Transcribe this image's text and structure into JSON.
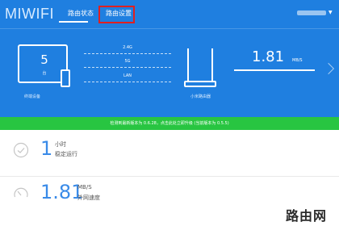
{
  "app": {
    "logo_text": "MIWIFI"
  },
  "nav": {
    "tabs": [
      {
        "label": "路由状态",
        "active": true
      },
      {
        "label": "路由设置",
        "active": false
      }
    ]
  },
  "dashboard": {
    "devices": {
      "count": "5",
      "count_caption": "台",
      "caption": "终端设备"
    },
    "connections": [
      "2.4G",
      "5G",
      "LAN"
    ],
    "router_caption": "小米路由器",
    "speed": {
      "value": "1.81",
      "unit": "MB/S"
    }
  },
  "notice": {
    "text": "检测到最新版本为 0.6.28，点击此处立即升级 (当前版本为 0.5.5)"
  },
  "stats": [
    {
      "value": "1",
      "unit": "小时",
      "description": "稳定运行",
      "icon": "check-circle-icon"
    },
    {
      "value": "1.81",
      "unit": "MB/S",
      "description": "外网速度",
      "icon": "speedometer-icon"
    }
  ],
  "watermark": {
    "text": "路由网"
  },
  "colors": {
    "header_bg": "#1f7fe0",
    "notice_bg": "#28c541",
    "accent": "#3a8be8",
    "highlight": "#e02020"
  }
}
